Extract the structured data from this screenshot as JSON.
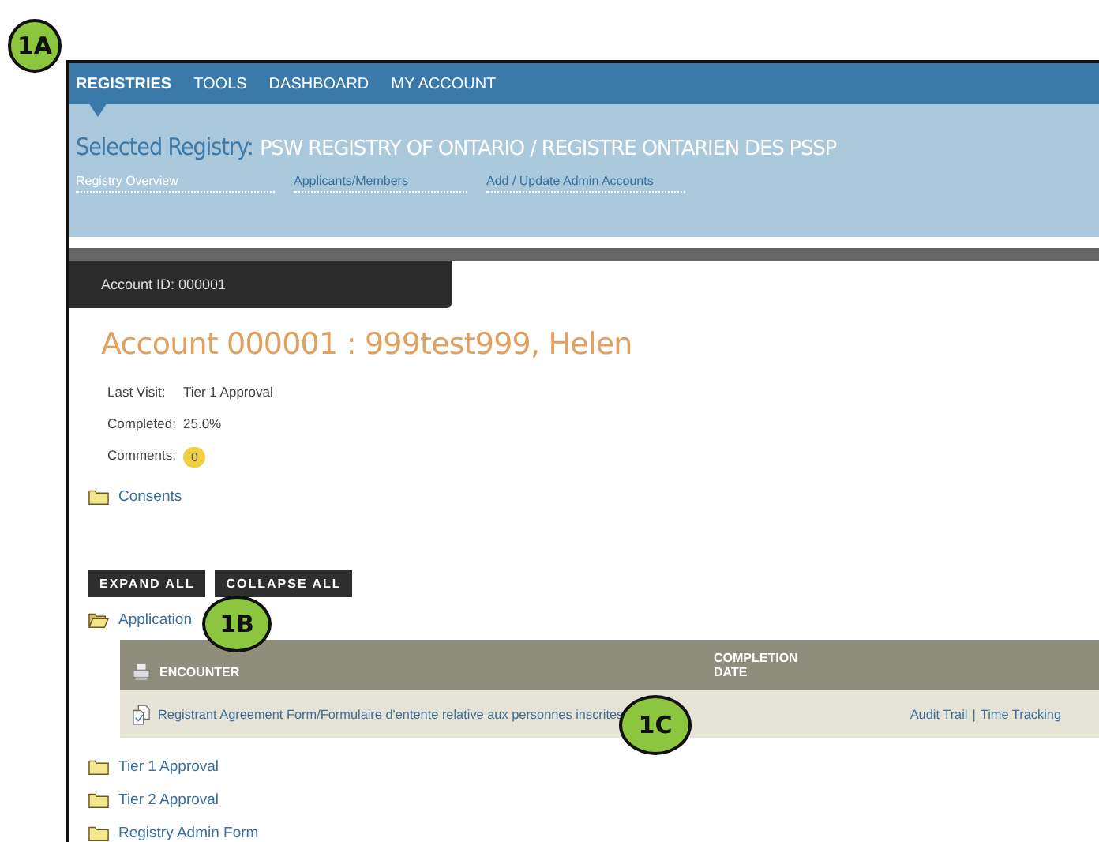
{
  "nav": [
    {
      "label": "REGISTRIES",
      "selected": true
    },
    {
      "label": "TOOLS",
      "selected": false
    },
    {
      "label": "DASHBOARD",
      "selected": false
    },
    {
      "label": "MY ACCOUNT",
      "selected": false
    }
  ],
  "registry": {
    "label": "Selected Registry:",
    "name": "PSW REGISTRY OF ONTARIO / REGISTRE ONTARIEN DES PSSP"
  },
  "subnav": [
    {
      "label": "Registry Overview",
      "selected": true
    },
    {
      "label": "Applicants/Members",
      "selected": false
    },
    {
      "label": "Add / Update Admin Accounts",
      "selected": false
    }
  ],
  "account_tab": "Account ID: 000001",
  "account_title": "Account 000001 : 999test999, Helen",
  "details": [
    {
      "label": "Last Visit:",
      "value": "Tier 1 Approval",
      "kind": "text"
    },
    {
      "label": "Completed:",
      "value": "25.0%",
      "kind": "text"
    },
    {
      "label": "Comments:",
      "value": "0",
      "kind": "bubble"
    }
  ],
  "consents": {
    "label": "Consents",
    "expanded": false
  },
  "buttons": [
    "EXPAND ALL",
    "COLLAPSE ALL"
  ],
  "folders": [
    {
      "label": "Application",
      "expanded": true,
      "table": {
        "columns": [
          "ENCOUNTER",
          "COMPLETION DATE"
        ],
        "rows": [
          {
            "encounter": "Registrant Agreement Form/Formulaire d'entente relative aux personnes inscrites",
            "completion_date": null,
            "links": [
              "Audit Trail",
              "Time Tracking"
            ],
            "separator": "|"
          }
        ]
      }
    },
    {
      "label": "Tier 1 Approval",
      "expanded": false
    },
    {
      "label": "Tier 2 Approval",
      "expanded": false
    },
    {
      "label": "Registry Admin Form",
      "expanded": false
    }
  ],
  "callouts": [
    "1A",
    "1B",
    "1C"
  ]
}
